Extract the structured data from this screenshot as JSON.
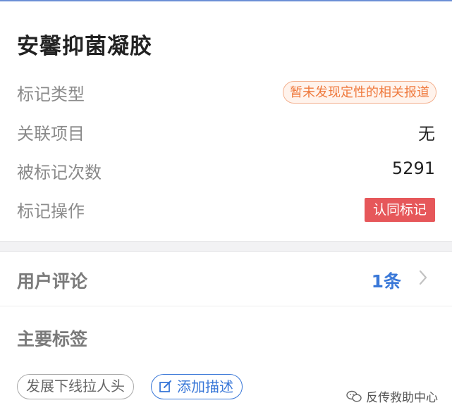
{
  "product": {
    "name": "安馨抑菌凝胶"
  },
  "details": {
    "mark_type_label": "标记类型",
    "mark_type_value": "暂未发现定性的相关报道",
    "related_label": "关联项目",
    "related_value": "无",
    "count_label": "被标记次数",
    "count_value": "5291",
    "action_label": "标记操作",
    "action_button": "认同标记"
  },
  "comments": {
    "label": "用户评论",
    "count": "1条"
  },
  "tags": {
    "label": "主要标签",
    "items": [
      "发展下线拉人头"
    ],
    "add_label": "添加描述"
  },
  "watermark": {
    "text": "反传救助中心"
  },
  "colors": {
    "accent": "#3a78d8",
    "danger": "#e6575a",
    "warning": "#ef7a3e"
  }
}
